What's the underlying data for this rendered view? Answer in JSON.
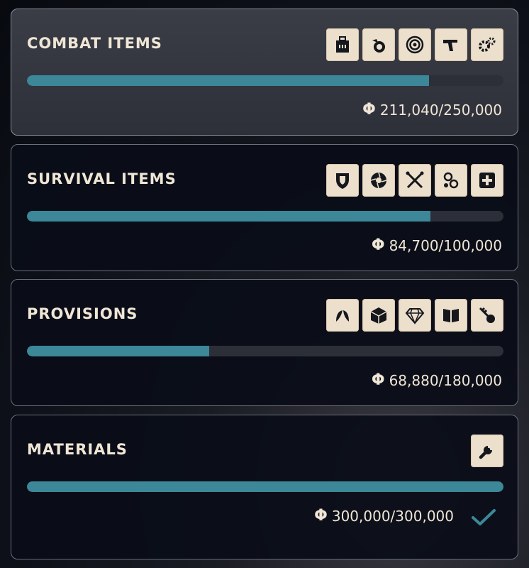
{
  "currency_symbol": "Φ",
  "accent_color": "#3c8798",
  "panels": [
    {
      "title": "COMBAT ITEMS",
      "current": 211040,
      "total": 250000,
      "amount_text": "211,040/250,000",
      "progress": 0.844,
      "icons": [
        "ammo-crate-icon",
        "grenade-icon",
        "target-icon",
        "pistol-icon",
        "gears-icon"
      ],
      "active": true,
      "complete": false
    },
    {
      "title": "SURVIVAL ITEMS",
      "current": 84700,
      "total": 100000,
      "amount_text": "84,700/100,000",
      "progress": 0.847,
      "icons": [
        "shield-icon",
        "aperture-icon",
        "crossed-tools-icon",
        "chain-icon",
        "medkit-icon"
      ],
      "active": false,
      "complete": false
    },
    {
      "title": "PROVISIONS",
      "current": 68880,
      "total": 180000,
      "amount_text": "68,880/180,000",
      "progress": 0.383,
      "icons": [
        "leaf-icon",
        "cube-icon",
        "gem-icon",
        "book-icon",
        "key-icon"
      ],
      "active": false,
      "complete": false
    },
    {
      "title": "MATERIALS",
      "current": 300000,
      "total": 300000,
      "amount_text": "300,000/300,000",
      "progress": 1.0,
      "icons": [
        "wrench-icon"
      ],
      "active": false,
      "complete": true
    }
  ]
}
